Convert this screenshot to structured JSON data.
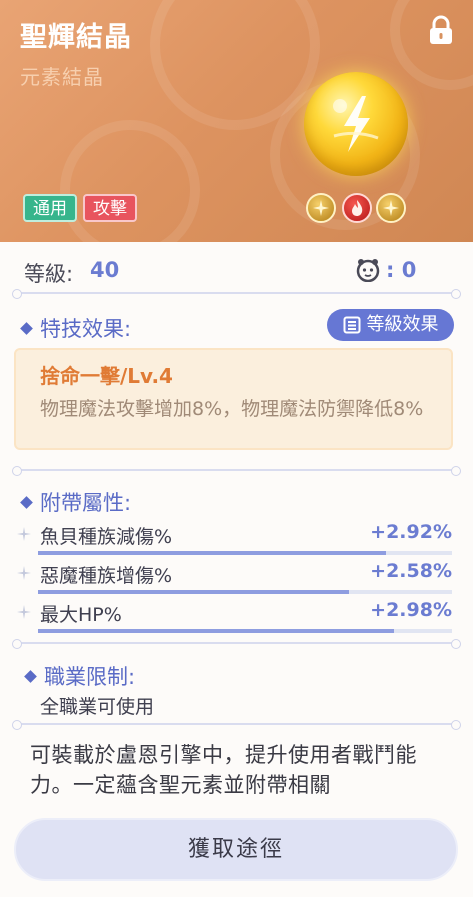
{
  "header": {
    "title": "聖輝結晶",
    "subtitle": "元素結晶",
    "tags": [
      "通用",
      "攻擊"
    ],
    "element_icons": [
      "gold-gem-icon",
      "fire-element-icon",
      "gold-gem-icon"
    ]
  },
  "stats": {
    "level_label": "等級:",
    "level_value": "40",
    "pet_count_value": ": 0"
  },
  "skill": {
    "section_title": "特技效果:",
    "level_button_label": "等級效果",
    "name": "捨命一擊/Lv.4",
    "description": "物理魔法攻擊增加8%，物理魔法防禦降低8%"
  },
  "attributes": {
    "section_title": "附帶屬性:",
    "items": [
      {
        "name": "魚貝種族減傷%",
        "value": "+2.92%",
        "fill_percent": 84
      },
      {
        "name": "惡魔種族增傷%",
        "value": "+2.58%",
        "fill_percent": 75
      },
      {
        "name": "最大HP%",
        "value": "+2.98%",
        "fill_percent": 86
      }
    ]
  },
  "restriction": {
    "section_title": "職業限制:",
    "value": "全職業可使用"
  },
  "description": "可裝載於盧恩引擎中，提升使用者戰鬥能力。一定蘊含聖元素並附帶相關",
  "acquire_button_label": "獲取途徑",
  "colors": {
    "header_bg": "#dd9360",
    "accent_blue": "#6677d4",
    "skill_name": "#e07b35",
    "tag_green": "#37b58c",
    "tag_red": "#e8545e"
  }
}
